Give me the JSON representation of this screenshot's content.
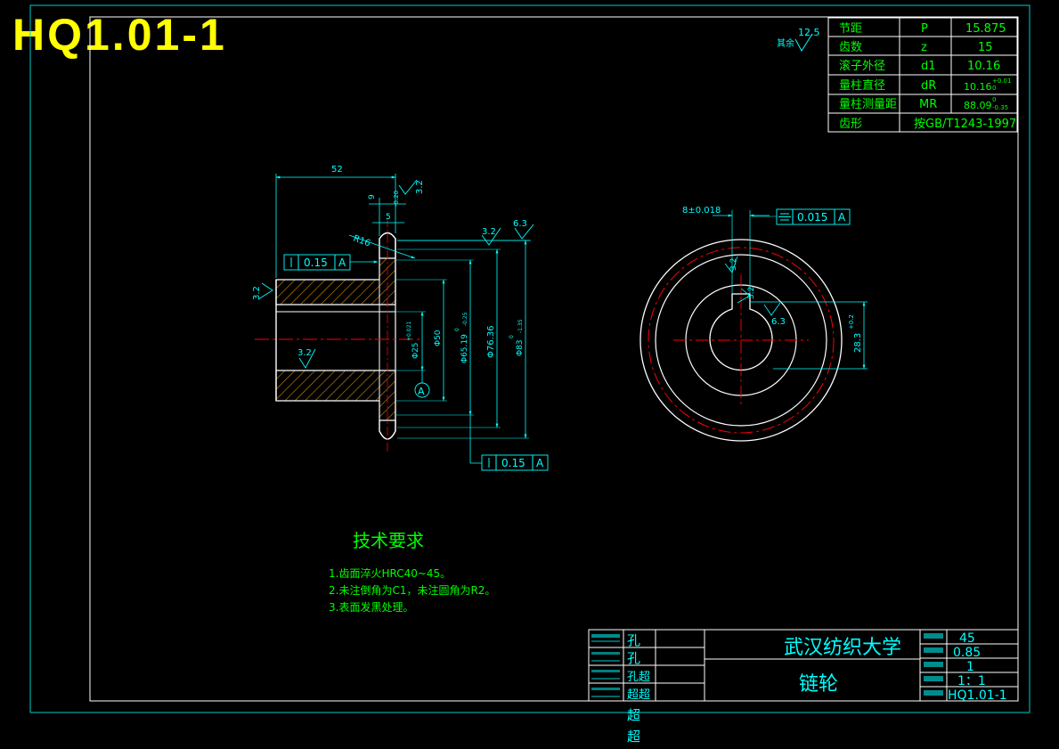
{
  "drawing_number": "HQ1.01-1",
  "roughness_general": "12.5",
  "roughness_general_note": "其余",
  "params": [
    {
      "name": "节距",
      "symbol": "P",
      "value": "15.875"
    },
    {
      "name": "齿数",
      "symbol": "z",
      "value": "15"
    },
    {
      "name": "滚子外径",
      "symbol": "d1",
      "value": "10.16"
    },
    {
      "name": "量柱直径",
      "symbol": "dR",
      "value": "10.16",
      "tol_upper": "+0.01",
      "tol_lower": "0"
    },
    {
      "name": "量柱测量距",
      "symbol": "MR",
      "value": "88.09",
      "tol_upper": "0",
      "tol_lower": "-0.35"
    },
    {
      "name": "齿形",
      "symbol": "",
      "value": "按GB/T1243-1997"
    }
  ],
  "section_view": {
    "dim_length": "52",
    "dim_width_9": "9",
    "dim_width_9_tol": "-0.20",
    "dim_width_5": "5",
    "radius": "R16",
    "rough_top": "3.2",
    "rough_rim": "3.2",
    "rough_rim_max": "6.3",
    "rough_left": "3.2",
    "rough_bore": "3.2",
    "tol_frame_top": {
      "value": "0.15",
      "datum": "A"
    },
    "tol_frame_bottom": {
      "value": "0.15",
      "datum": "A"
    },
    "datum_label": "A",
    "dim_bore": "Φ25",
    "dim_bore_tol": "+0.021",
    "dim_hub": "Φ50",
    "dim_root": "Φ65.19",
    "dim_root_tol_upper": "0",
    "dim_root_tol_lower": "-0.25",
    "dim_pitch": "Φ76.36",
    "dim_outer": "Φ83",
    "dim_outer_tol_upper": "0",
    "dim_outer_tol_lower": "-1.35"
  },
  "front_view": {
    "dim_key_width": "8±0.018",
    "sym_frame": {
      "value": "0.015",
      "datum": "A"
    },
    "rough_key_1": "3.2",
    "rough_key_2": "3.2",
    "rough_bore": "6.3",
    "dim_key_depth": "28.3",
    "dim_key_depth_tol": "+0.2"
  },
  "tech_req": {
    "title": "技术要求",
    "items": [
      "1.齿面淬火HRC40~45。",
      "2.未注倒角为C1，未注圆角为R2。",
      "3.表面发黑处理。"
    ]
  },
  "title_block": {
    "university": "武汉纺织大学",
    "part_name": "链轮",
    "material": "45",
    "weight": "0.85",
    "quantity": "1",
    "scale": "1：1",
    "drawing_no": "HQ1.01-1",
    "names": [
      "孔",
      "孔",
      "孔超",
      "超超",
      "超",
      "超"
    ]
  },
  "colors": {
    "line": "#ffffff",
    "dimension": "#00ffff",
    "text": "#00ff00",
    "center": "#ff0000",
    "title": "#ffff00",
    "frame": "#00cccc"
  }
}
